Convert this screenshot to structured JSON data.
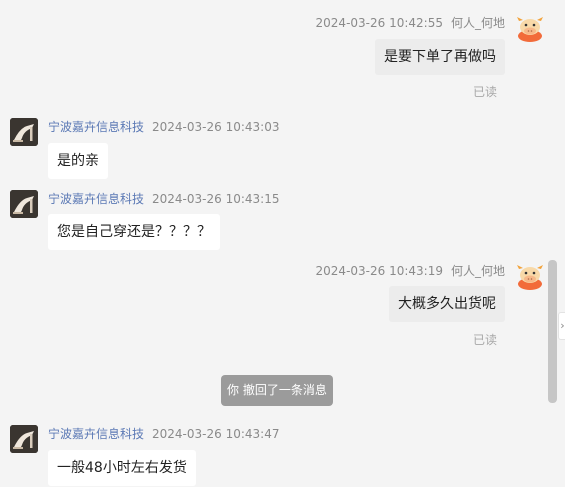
{
  "messages": [
    {
      "sender": "何人_何地",
      "time": "2024-03-26 10:42:55",
      "text": "是要下单了再做吗",
      "status": "已读"
    },
    {
      "sender": "宁波嘉卉信息科技",
      "time": "2024-03-26 10:43:03",
      "text": "是的亲"
    },
    {
      "sender": "宁波嘉卉信息科技",
      "time": "2024-03-26 10:43:15",
      "text": "您是自己穿还是？？？？"
    },
    {
      "sender": "何人_何地",
      "time": "2024-03-26 10:43:19",
      "text": "大概多久出货呢",
      "status": "已读"
    },
    {
      "sender": "宁波嘉卉信息科技",
      "time": "2024-03-26 10:43:47",
      "text": "一般48小时左右发货"
    }
  ],
  "system_note": "你 撤回了一条消息",
  "side_arrow_glyph": "›",
  "colors": {
    "background": "#f4f4f4",
    "shop_name": "#5b79b5",
    "own_bubble": "#ececec",
    "their_bubble": "#ffffff",
    "system_note_bg": "#9b9b9b"
  },
  "icons": {
    "self_avatar": "cartoon-cow-avatar-icon",
    "shop_avatar": "high-heel-shoe-avatar-icon"
  }
}
